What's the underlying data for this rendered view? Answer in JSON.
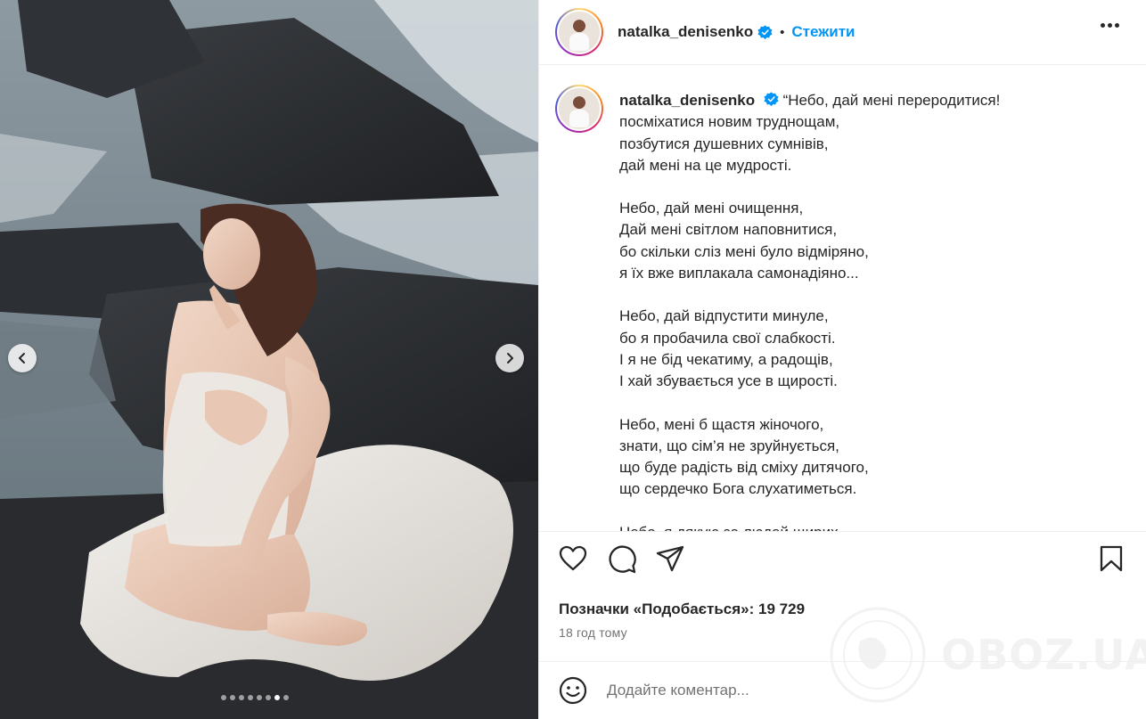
{
  "post": {
    "username": "natalka_denisenko",
    "follow_label": "Стежити",
    "separator": "•",
    "caption": {
      "username": "natalka_denisenko",
      "first_line": "“Небо, дай мені переродитися!",
      "stanza1": [
        "посміхатися новим труднощам,",
        "позбутися душевних сумнівів,",
        "дай мені на це мудрості."
      ],
      "stanza2": [
        "Небо, дай мені очищення,",
        "Дай мені світлом наповнитися,",
        "бо скільки сліз мені було відміряно,",
        "я їх вже виплакала самонадіяно..."
      ],
      "stanza3": [
        "Небо, дай відпустити минуле,",
        "бо я пробачила свої слабкості.",
        "І я не бід чекатиму, а радощів,",
        "І хай збувається усе в щирості."
      ],
      "stanza4": [
        "Небо, мені б щастя жіночого,",
        "знати, що сім’я не зруйнується,",
        "що буде радість від сміху дитячого,",
        "що сердечко Бога слухатиметься."
      ],
      "stanza5": [
        "Небо, я дякую за людей щирих"
      ]
    },
    "likes_text": "Позначки «Подобається»: 19 729",
    "time_ago": "18 год тому",
    "comment_placeholder": "Додайте коментар...",
    "carousel": {
      "total_slides": 8,
      "active_index": 6
    }
  },
  "watermark": {
    "text": "OBOZ.UA"
  },
  "icons": {
    "verified": "verified-badge-icon",
    "more": "more-options-icon",
    "like": "heart-icon",
    "comment": "comment-icon",
    "share": "send-icon",
    "save": "bookmark-icon",
    "emoji": "emoji-icon",
    "prev": "chevron-left-icon",
    "next": "chevron-right-icon"
  },
  "colors": {
    "accent": "#0095f6",
    "text": "#262626",
    "muted": "#737373",
    "verified": "#0095f6"
  }
}
